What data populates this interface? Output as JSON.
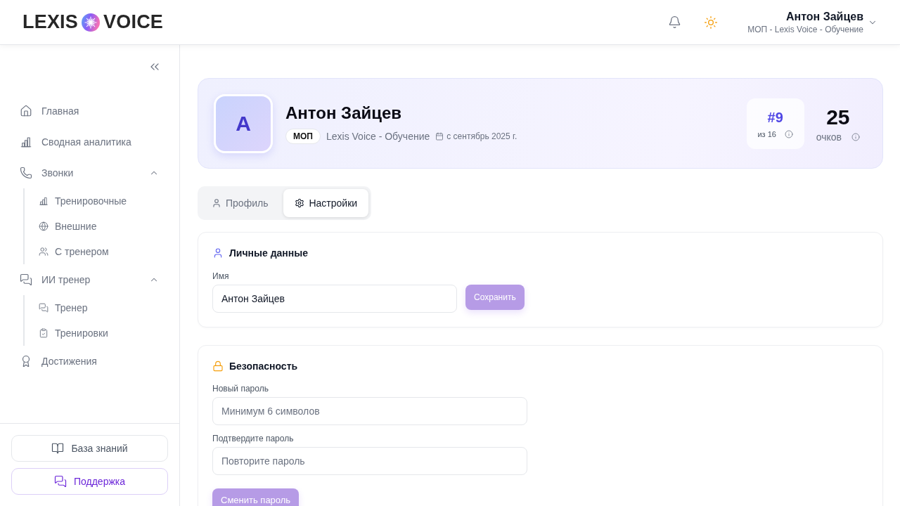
{
  "header": {
    "logo": {
      "word_1": "LEXIS",
      "word_2": "VOICE"
    },
    "user": {
      "name": "Антон Зайцев",
      "subtitle": "МОП - Lexis Voice - Обучение"
    }
  },
  "sidebar": {
    "items": [
      {
        "label": "Главная",
        "selected": false
      },
      {
        "label": "Сводная аналитика",
        "selected": false
      },
      {
        "label": "Звонки",
        "selected": false,
        "expanded": true,
        "children": [
          {
            "label": "Тренировочные",
            "selected": false
          },
          {
            "label": "Внешние",
            "selected": false
          },
          {
            "label": "С тренером",
            "selected": false
          }
        ]
      },
      {
        "label": "ИИ тренер",
        "selected": false,
        "expanded": true,
        "children": [
          {
            "label": "Тренер",
            "selected": false
          },
          {
            "label": "Тренировки",
            "selected": false
          }
        ]
      },
      {
        "label": "Достижения",
        "selected": false
      }
    ],
    "footer_buttons": [
      {
        "label": "База знаний",
        "kind": "plain"
      },
      {
        "label": "Поддержка",
        "kind": "accent"
      }
    ]
  },
  "profile": {
    "avatar_letter": "А",
    "name": "Антон Зайцев",
    "role_badge": "МОП",
    "team": "Lexis Voice - Обучение",
    "since": "с сентябрь 2025 г.",
    "rank": {
      "value": "#9",
      "of": "из 16"
    },
    "points": {
      "value": "25",
      "label": "очков"
    }
  },
  "tabs": [
    {
      "label": "Профиль",
      "selected": false
    },
    {
      "label": "Настройки",
      "selected": true
    }
  ],
  "personal_data": {
    "title": "Личные данные",
    "fields": [
      {
        "label": "Имя",
        "value": "Антон Зайцев"
      }
    ],
    "button": {
      "label": "Сохранить",
      "disabled": true
    }
  },
  "security": {
    "title": "Безопасность",
    "fields": [
      {
        "label": "Новый пароль",
        "placeholder": "Минимум 6 символов"
      },
      {
        "label": "Подтвердите пароль",
        "placeholder": "Повторите пароль"
      }
    ],
    "button": {
      "label": "Сменить пароль",
      "disabled": true
    }
  }
}
